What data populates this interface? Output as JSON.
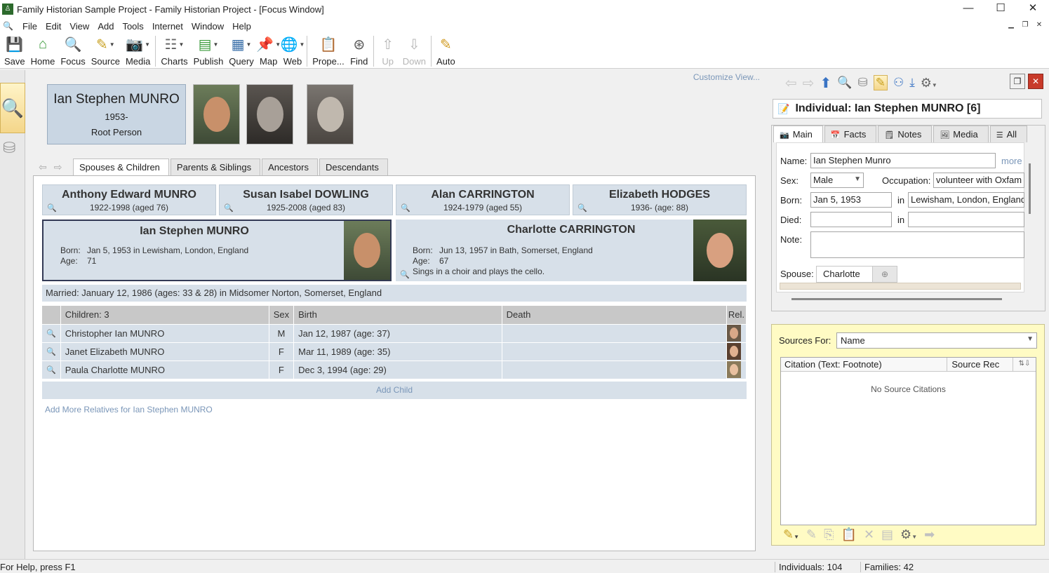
{
  "window": {
    "title": "Family Historian Sample Project - Family Historian Project - [Focus Window]"
  },
  "menu": [
    "File",
    "Edit",
    "View",
    "Add",
    "Tools",
    "Internet",
    "Window",
    "Help"
  ],
  "toolbar": [
    {
      "id": "save",
      "label": "Save",
      "icon": "floppy-icon",
      "dropdown": false,
      "disabled": false
    },
    {
      "id": "home",
      "label": "Home",
      "icon": "house-icon",
      "dropdown": false,
      "disabled": false
    },
    {
      "id": "focus",
      "label": "Focus",
      "icon": "magnifier-icon",
      "dropdown": false,
      "disabled": false
    },
    {
      "id": "source",
      "label": "Source",
      "icon": "source-add-icon",
      "dropdown": true,
      "disabled": false
    },
    {
      "id": "media",
      "label": "Media",
      "icon": "camera-icon",
      "dropdown": true,
      "disabled": false
    },
    {
      "id": "charts",
      "label": "Charts",
      "icon": "chart-icon",
      "dropdown": true,
      "disabled": false
    },
    {
      "id": "publish",
      "label": "Publish",
      "icon": "publish-icon",
      "dropdown": true,
      "disabled": false
    },
    {
      "id": "query",
      "label": "Query",
      "icon": "query-icon",
      "dropdown": true,
      "disabled": false
    },
    {
      "id": "map",
      "label": "Map",
      "icon": "map-pin-icon",
      "dropdown": true,
      "disabled": false
    },
    {
      "id": "web",
      "label": "Web",
      "icon": "globe-icon",
      "dropdown": true,
      "disabled": false
    },
    {
      "id": "properties",
      "label": "Prope...",
      "icon": "properties-icon",
      "dropdown": false,
      "disabled": false
    },
    {
      "id": "find",
      "label": "Find",
      "icon": "binoculars-icon",
      "dropdown": false,
      "disabled": false
    },
    {
      "id": "up",
      "label": "Up",
      "icon": "arrow-up-icon",
      "dropdown": false,
      "disabled": true
    },
    {
      "id": "down",
      "label": "Down",
      "icon": "arrow-down-icon",
      "dropdown": false,
      "disabled": true
    },
    {
      "id": "auto",
      "label": "Auto",
      "icon": "auto-pencil-icon",
      "dropdown": false,
      "disabled": false
    }
  ],
  "main": {
    "customize_link": "Customize View...",
    "focus_person": {
      "name": "Ian Stephen MUNRO",
      "years": "1953-",
      "role": "Root Person"
    },
    "tabs": [
      "Spouses & Children",
      "Parents & Siblings",
      "Ancestors",
      "Descendants"
    ],
    "parents": [
      {
        "name": "Anthony Edward MUNRO",
        "dates": "1922-1998 (aged 76)"
      },
      {
        "name": "Susan Isabel DOWLING",
        "dates": "1925-2008 (aged 83)"
      },
      {
        "name": "Alan CARRINGTON",
        "dates": "1924-1979 (aged 55)"
      },
      {
        "name": "Elizabeth HODGES",
        "dates": "1936- (age: 88)"
      }
    ],
    "person": {
      "name": "Ian Stephen MUNRO",
      "born_label": "Born:",
      "born": "Jan 5, 1953 in Lewisham, London, England",
      "age_label": "Age:",
      "age": "71"
    },
    "spouse": {
      "name": "Charlotte CARRINGTON",
      "born_label": "Born:",
      "born": "Jun 13, 1957 in Bath, Somerset, England",
      "age_label": "Age:",
      "age": "67",
      "note": "Sings in a choir and plays the cello."
    },
    "married": "Married: January 12, 1986 (ages: 33 & 28) in Midsomer Norton, Somerset, England",
    "children_table": {
      "headers": [
        "Children: 3",
        "Sex",
        "Birth",
        "Death",
        "Rel."
      ],
      "rows": [
        {
          "name": "Christopher Ian MUNRO",
          "sex": "M",
          "birth": "Jan 12, 1987 (age: 37)",
          "death": ""
        },
        {
          "name": "Janet Elizabeth MUNRO",
          "sex": "F",
          "birth": "Mar 11, 1989 (age: 35)",
          "death": ""
        },
        {
          "name": "Paula Charlotte MUNRO",
          "sex": "F",
          "birth": "Dec 3, 1994 (age: 29)",
          "death": ""
        }
      ]
    },
    "add_child": "Add Child",
    "add_more": "Add More Relatives for Ian Stephen MUNRO"
  },
  "property_box": {
    "header": "Individual: Ian Stephen MUNRO [6]",
    "tabs": [
      "Main",
      "Facts",
      "Notes",
      "Media",
      "All"
    ],
    "labels": {
      "name": "Name:",
      "sex": "Sex:",
      "occupation": "Occupation:",
      "born": "Born:",
      "died": "Died:",
      "in": "in",
      "note": "Note:",
      "spouse": "Spouse:",
      "more": "more"
    },
    "fields": {
      "name": "Ian Stephen Munro",
      "sex": "Male",
      "occupation": "volunteer with Oxfam",
      "born_date": "Jan 5, 1953",
      "born_place": "Lewisham, London, England",
      "died_date": "",
      "died_place": "",
      "note": ""
    },
    "spouse_tab": "Charlotte"
  },
  "sources": {
    "label": "Sources For:",
    "selected": "Name",
    "columns": [
      "Citation (Text: Footnote)",
      "Source Rec"
    ],
    "empty": "No Source Citations"
  },
  "status": {
    "help": "For Help, press F1",
    "individuals": "Individuals: 104",
    "families": "Families: 42"
  }
}
